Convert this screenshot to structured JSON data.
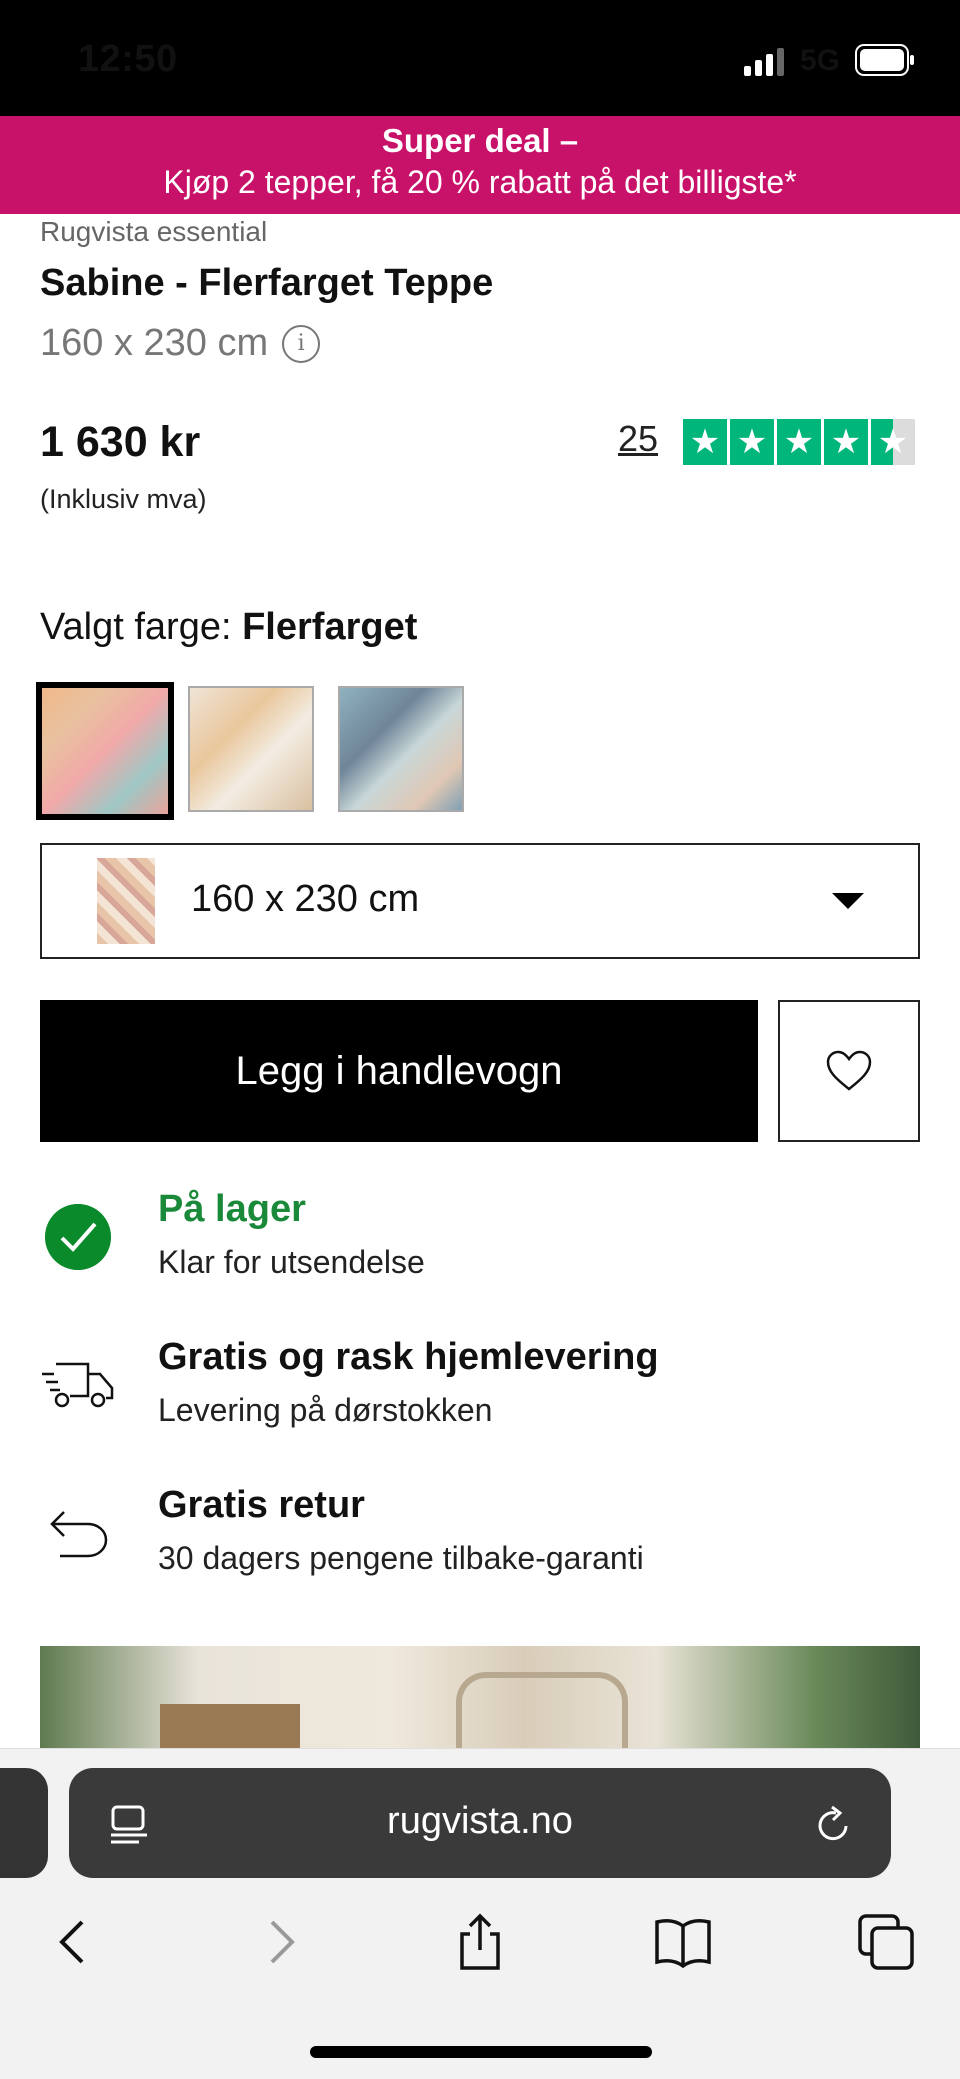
{
  "status_bar": {
    "time": "12:50",
    "network": "5G"
  },
  "promo": {
    "title": "Super deal –",
    "text": "Kjøp 2 tepper, få 20 % rabatt på det billigste*"
  },
  "product": {
    "brand": "Rugvista essential",
    "name": "Sabine - Flerfarget Teppe",
    "size": "160 x 230 cm",
    "price": "1 630 kr",
    "vat_note": "(Inklusiv mva)",
    "review_count": "25",
    "rating": 4.5,
    "rating_color": "#00b67a",
    "color_label": "Valgt farge:",
    "color_value": "Flerfarget",
    "swatches": [
      "multicolor",
      "beige",
      "blue"
    ],
    "selected_swatch": 0,
    "size_select_value": "160 x 230 cm"
  },
  "actions": {
    "add_to_cart": "Legg i handlevogn",
    "wishlist_icon": "heart-icon"
  },
  "delivery": [
    {
      "icon": "check-circle-icon",
      "title": "På lager",
      "subtitle": "Klar for utsendelse"
    },
    {
      "icon": "delivery-truck-icon",
      "title": "Gratis og rask hjemlevering",
      "subtitle": "Levering på dørstokken"
    },
    {
      "icon": "return-arrow-icon",
      "title": "Gratis retur",
      "subtitle": "30 dagers pengene tilbake-garanti"
    }
  ],
  "browser": {
    "url": "rugvista.no",
    "icons": [
      "back-icon",
      "forward-icon",
      "share-icon",
      "bookmarks-icon",
      "tabs-icon"
    ]
  },
  "colors": {
    "promo": "#c8126a",
    "in_stock": "#1a8a3a",
    "cart_button": "#000000"
  }
}
